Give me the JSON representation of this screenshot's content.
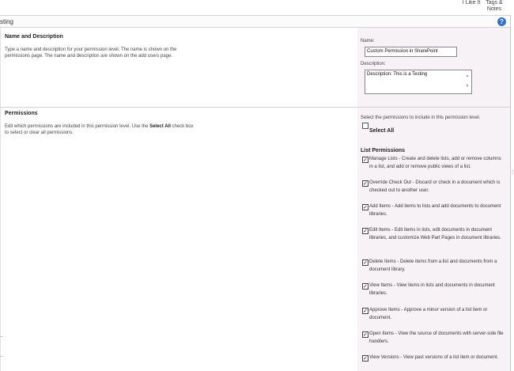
{
  "ribbon": {
    "like_label": "I Like It",
    "tags_label": "Tags & Notes"
  },
  "titlebar": {
    "text": "sting"
  },
  "name_section": {
    "title": "Name and Description",
    "desc": "Type a name and description for your permission level.  The name is shown on the permissions page.  The name and description are shown on the add users page.",
    "name_label": "Name:",
    "name_value": "Custom Permission in SharePoint",
    "desc_label": "Description:",
    "desc_value": "Description: This is a Testing"
  },
  "permissions_section": {
    "title": "Permissions",
    "desc_before": "Edit which permissions are included in this permission level. Use the ",
    "desc_bold": "Select All",
    "desc_after": " check box to select or clear all permissions.",
    "intro": "Select the permissions to include in this permission level.",
    "select_all": "Select All",
    "group_title": "List Permissions",
    "items": [
      {
        "text": "Manage Lists  -  Create and delete lists, add or remove columns in a list, and add or remove public views of a list.",
        "checked": true
      },
      {
        "text": "Override Check Out  -  Discard or check in a document which is checked out to another user.",
        "checked": true
      },
      {
        "text": "Add Items  -  Add items to lists and add documents to document libraries.",
        "checked": true
      },
      {
        "text": "Edit Items  -  Edit items in lists, edit documents in document libraries, and customize Web Part Pages in document libraries.",
        "checked": true
      },
      {
        "text": "Delete Items  -  Delete items from a list and documents from a document library.",
        "checked": true
      },
      {
        "text": "View Items  -  View items in lists and documents in document libraries.",
        "checked": true
      },
      {
        "text": "Approve Items  -  Approve a minor version of a list item or document.",
        "checked": true
      },
      {
        "text": "Open Items  -  View the source of documents with server-side file handlers.",
        "checked": true
      },
      {
        "text": "View Versions  -  View past versions of a list item or document.",
        "checked": true
      }
    ]
  }
}
